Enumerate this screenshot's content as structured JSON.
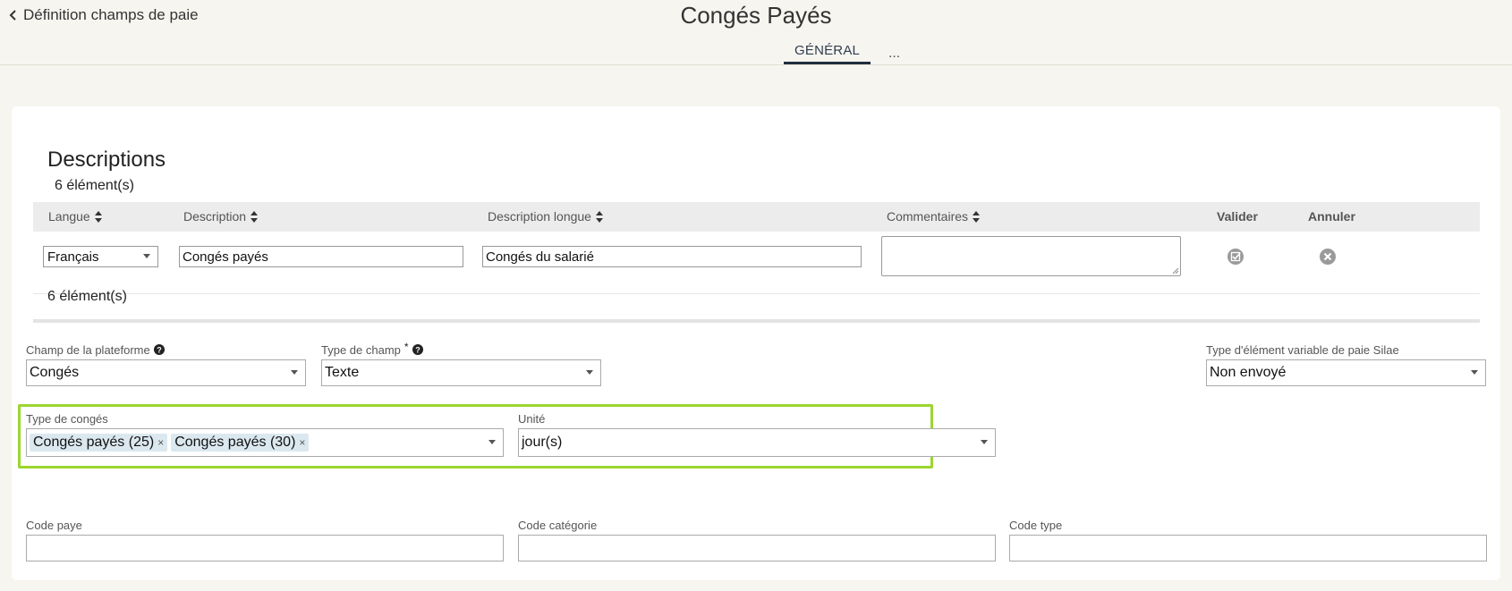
{
  "header": {
    "back_label": "Définition champs de paie",
    "title": "Congés Payés",
    "tabs": [
      {
        "label": "GÉNÉRAL"
      },
      {
        "label": "..."
      }
    ]
  },
  "descriptions": {
    "title": "Descriptions",
    "count_top": "6 élément(s)",
    "count_bottom": "6 élément(s)",
    "columns": {
      "langue": "Langue",
      "description": "Description",
      "description_longue": "Description longue",
      "commentaires": "Commentaires",
      "valider": "Valider",
      "annuler": "Annuler"
    },
    "row": {
      "langue": "Français",
      "description": "Congés payés",
      "description_longue": "Congés du salarié",
      "commentaires": ""
    }
  },
  "form": {
    "champ_plateforme": {
      "label": "Champ de la plateforme",
      "value": "Congés"
    },
    "type_champ": {
      "label": "Type de champ",
      "required_mark": "*",
      "value": "Texte"
    },
    "type_element_silae": {
      "label": "Type d'élément variable de paie Silae",
      "value": "Non envoyé"
    },
    "type_conges": {
      "label": "Type de congés",
      "chips": [
        "Congés payés (25)",
        "Congés payés (30)"
      ]
    },
    "unite": {
      "label": "Unité",
      "value": "jour(s)"
    },
    "code_paye": {
      "label": "Code paye",
      "value": ""
    },
    "code_categorie": {
      "label": "Code catégorie",
      "value": ""
    },
    "code_type": {
      "label": "Code type",
      "value": ""
    }
  },
  "colors": {
    "highlight": "#9bd62f",
    "chip_bg": "#dbe8ef",
    "page_bg": "#f7f5f0"
  },
  "icons": {
    "back": "chevron-left-icon",
    "sort": "sort-icon",
    "help": "help-circle-icon",
    "validate": "check-square-icon",
    "cancel": "close-circle-icon"
  }
}
